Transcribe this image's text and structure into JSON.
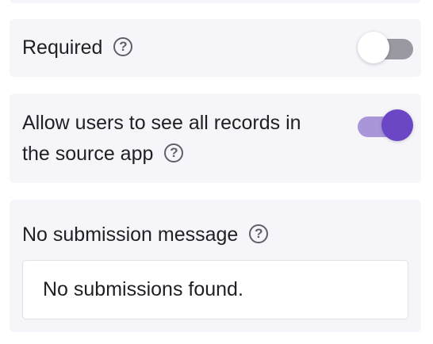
{
  "required_setting": {
    "label": "Required",
    "help_icon": "?",
    "toggle_state": "off"
  },
  "allow_users_setting": {
    "label_line1": "Allow users to see all records in",
    "label_line2": "the source app",
    "help_icon": "?",
    "toggle_state": "on"
  },
  "no_submission_setting": {
    "label": "No submission message",
    "help_icon": "?",
    "value": "No submissions found."
  },
  "colors": {
    "panel_background": "#f6f5fa",
    "toggle_on_knob": "#6b47c6",
    "toggle_on_track": "#a896d9",
    "toggle_off_track": "#9a99a1"
  }
}
